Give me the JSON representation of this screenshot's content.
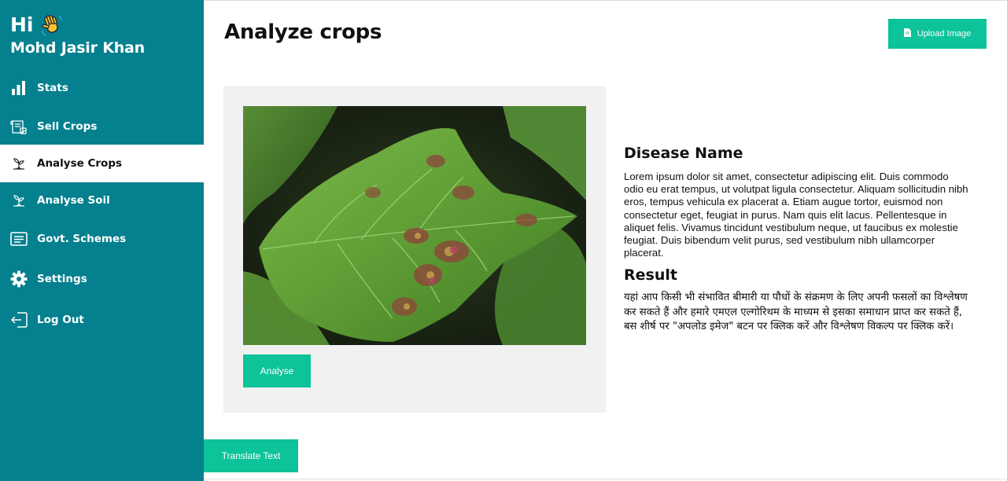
{
  "sidebar": {
    "greeting": "Hi",
    "user_name": "Mohd Jasir Khan",
    "items": [
      {
        "label": "Stats",
        "icon": "bar-chart-icon"
      },
      {
        "label": "Sell Crops",
        "icon": "receipt-icon"
      },
      {
        "label": "Analyse Crops",
        "icon": "sprout-icon",
        "active": true
      },
      {
        "label": "Analyse Soil",
        "icon": "sprout-icon"
      },
      {
        "label": "Govt. Schemes",
        "icon": "document-list-icon"
      },
      {
        "label": "Settings",
        "icon": "gear-icon"
      },
      {
        "label": "Log Out",
        "icon": "logout-icon"
      }
    ]
  },
  "header": {
    "title": "Analyze crops",
    "upload_label": "Upload Image"
  },
  "analysis": {
    "analyse_label": "Analyse",
    "disease_title": "Disease Name",
    "disease_desc": "Lorem ipsum dolor sit amet, consectetur adipiscing elit. Duis commodo odio eu erat tempus, ut volutpat ligula consectetur. Aliquam sollicitudin nibh eros, tempus vehicula ex placerat a. Etiam augue tortor, euismod non consectetur eget, feugiat in purus. Nam quis elit lacus. Pellentesque in aliquet felis. Vivamus tincidunt vestibulum neque, ut faucibus ex molestie feugiat. Duis bibendum velit purus, sed vestibulum nibh ullamcorper placerat.",
    "result_title": "Result",
    "result_desc": "यहां आप किसी भी संभावित बीमारी या पौधों के संक्रमण के लिए अपनी फसलों का विश्लेषण कर सकते हैं और हमारे एमएल एल्गोरिथम के माध्यम से इसका समाधान प्राप्त कर सकते हैं, बस शीर्ष पर \"अपलोड इमेज\" बटन पर क्लिक करें और विश्लेषण विकल्प पर क्लिक करें।"
  },
  "footer": {
    "translate_label": "Translate Text"
  },
  "colors": {
    "sidebar": "#04808e",
    "accent": "#0cc39a",
    "card": "#f1f1f1"
  }
}
